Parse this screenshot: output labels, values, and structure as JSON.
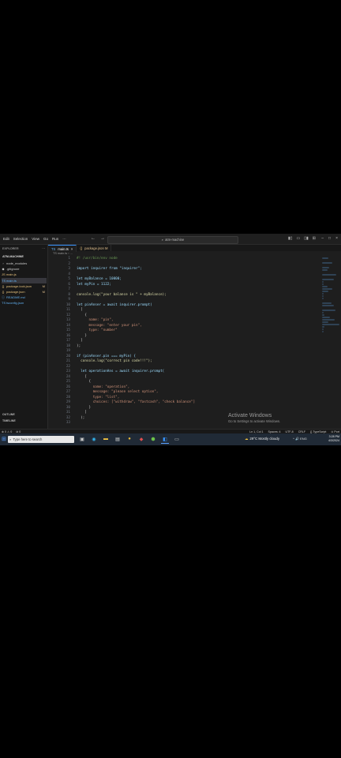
{
  "titlebar": {
    "menu": [
      "Edit",
      "Selection",
      "View",
      "Go",
      "Run",
      "···"
    ],
    "search_text": "atm-machine",
    "nav_back": "←",
    "nav_forward": "→"
  },
  "sidebar": {
    "header": "EXPLORER",
    "header_more": "···",
    "project": "ATM-MACHINE",
    "items": [
      {
        "icon": "›",
        "label": "node_modules",
        "color": "#cccccc"
      },
      {
        "icon": "◆",
        "label": ".gitignore",
        "color": "#cccccc"
      },
      {
        "icon": "JS",
        "label": "main.js",
        "color": "#e5c07b"
      },
      {
        "icon": "TS",
        "label": "main.ts",
        "color": "#61afef"
      },
      {
        "icon": "{}",
        "label": "package-lock.json",
        "color": "#e5c07b"
      },
      {
        "icon": "{}",
        "label": "package.json",
        "color": "#e5c07b"
      },
      {
        "icon": "ⓘ",
        "label": "README.md",
        "color": "#61afef"
      },
      {
        "icon": "TS",
        "label": "tsconfig.json",
        "color": "#61afef"
      }
    ],
    "item_badges": [
      "",
      "",
      "",
      "",
      "M",
      "M",
      "",
      ""
    ],
    "outline": "OUTLINE",
    "timeline": "TIMELINE"
  },
  "tabs": [
    {
      "label": "main.ts",
      "icon": "TS",
      "close": "×",
      "active": true
    },
    {
      "label": "package.json M",
      "icon": "{}",
      "close": "",
      "active": false
    }
  ],
  "breadcrumb": "TS main.ts › ...",
  "code": [
    {
      "n": "1",
      "t": "#! /usr/bin/env node"
    },
    {
      "n": "2",
      "t": ""
    },
    {
      "n": "3",
      "t": "import inquirer from \"inquirer\";"
    },
    {
      "n": "4",
      "t": ""
    },
    {
      "n": "5",
      "t": "let myBalance = 10000;"
    },
    {
      "n": "6",
      "t": "let myPin = 1122;"
    },
    {
      "n": "7",
      "t": ""
    },
    {
      "n": "8",
      "t": "console.log(\"your balance is \" + myBalance);"
    },
    {
      "n": "9",
      "t": ""
    },
    {
      "n": "10",
      "t": "let pinAnser = await inquirer.prompt("
    },
    {
      "n": "11",
      "t": "  ["
    },
    {
      "n": "12",
      "t": "    {"
    },
    {
      "n": "13",
      "t": "      name: \"pin\","
    },
    {
      "n": "14",
      "t": "      message: \"enter your pin\","
    },
    {
      "n": "15",
      "t": "      type: \"number\""
    },
    {
      "n": "16",
      "t": "    }"
    },
    {
      "n": "17",
      "t": "  ]"
    },
    {
      "n": "18",
      "t": ");"
    },
    {
      "n": "19",
      "t": ""
    },
    {
      "n": "20",
      "t": "if (pinAnser.pin === myPin) {"
    },
    {
      "n": "21",
      "t": "  console.log(\"correct pin code!!!\");"
    },
    {
      "n": "22",
      "t": ""
    },
    {
      "n": "23",
      "t": "  let operationAns = await inquirer.prompt("
    },
    {
      "n": "24",
      "t": "    ["
    },
    {
      "n": "25",
      "t": "      {"
    },
    {
      "n": "26",
      "t": "        name: \"operation\","
    },
    {
      "n": "27",
      "t": "        message: \"please select option\","
    },
    {
      "n": "28",
      "t": "        type: \"list\","
    },
    {
      "n": "29",
      "t": "        choices: [\"withdraw\", \"fastcash\", \"check balance\"]"
    },
    {
      "n": "30",
      "t": "      }"
    },
    {
      "n": "31",
      "t": "    ]"
    },
    {
      "n": "32",
      "t": "  );"
    },
    {
      "n": "33",
      "t": ""
    }
  ],
  "watermark": {
    "title": "Activate Windows",
    "subtitle": "Go to Settings to activate Windows."
  },
  "statusbar": {
    "left": [
      "⊗ 0 ⚠ 0",
      "⊘ 0"
    ],
    "right": [
      "Ln 1, Col 1",
      "Spaces: 4",
      "UTF-8",
      "CRLF",
      "{} TypeScript",
      "⊙ Port"
    ]
  },
  "taskbar": {
    "search_placeholder": "Type here to search",
    "weather": "29°C  Mostly cloudy",
    "tray": "^ 🔊 ENG",
    "time": "3:28 PM",
    "date": "4/3/2024"
  },
  "colors": {
    "accent": "#3794ff",
    "editor_bg": "#1e1e1e",
    "sidebar_bg": "#181818"
  }
}
